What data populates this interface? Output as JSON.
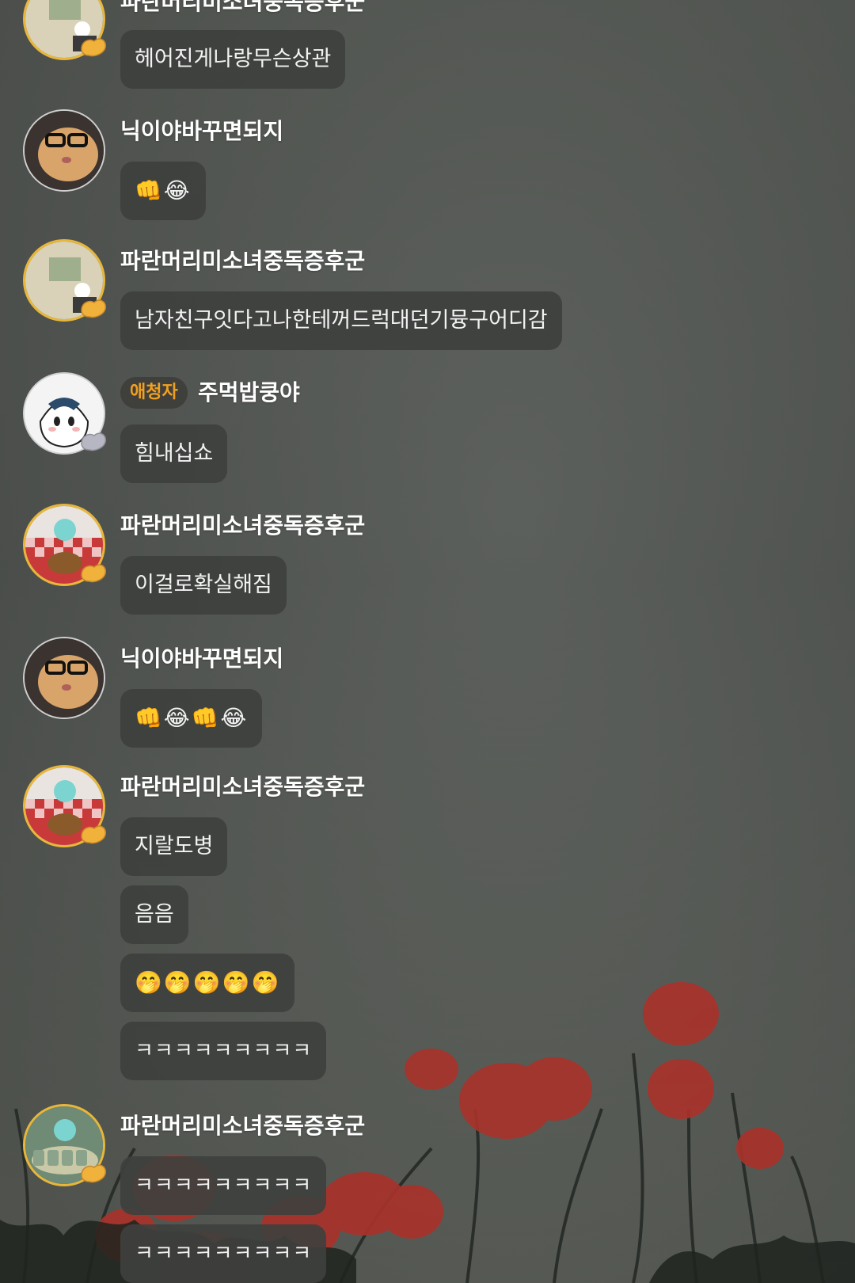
{
  "messages": [
    {
      "name": "파란머리미소녀중독증후군",
      "texts": [
        "헤어진게나랑무슨상관"
      ]
    },
    {
      "name": "닉이야바꾸면되지",
      "texts": [
        "👊😂"
      ]
    },
    {
      "name": "파란머리미소녀중독증후군",
      "texts": [
        "남자친구잇다고나한테꺼드럭대던기뮹구어디감"
      ]
    },
    {
      "badge": "애청자",
      "name": "주먹밥쿵야",
      "texts": [
        "힘내십쇼"
      ]
    },
    {
      "name": "파란머리미소녀중독증후군",
      "texts": [
        "이걸로확실해짐"
      ]
    },
    {
      "name": "닉이야바꾸면되지",
      "texts": [
        "👊😂👊😂"
      ]
    },
    {
      "name": "파란머리미소녀중독증후군",
      "texts": [
        "지랄도병",
        "음음",
        "🤭🤭🤭🤭🤭",
        "ㅋㅋㅋㅋㅋㅋㅋㅋㅋ"
      ]
    },
    {
      "name": "파란머리미소녀중독증후군",
      "texts": [
        "ㅋㅋㅋㅋㅋㅋㅋㅋㅋ",
        "ㅋㅋㅋㅋㅋㅋㅋㅋㅋ"
      ]
    }
  ],
  "icons": {
    "avatar_badge": "hand-heart-icon",
    "background": "poppy-flowers"
  },
  "colors": {
    "accent_gold": "#e8b73a",
    "badge_text": "#f0a020"
  }
}
